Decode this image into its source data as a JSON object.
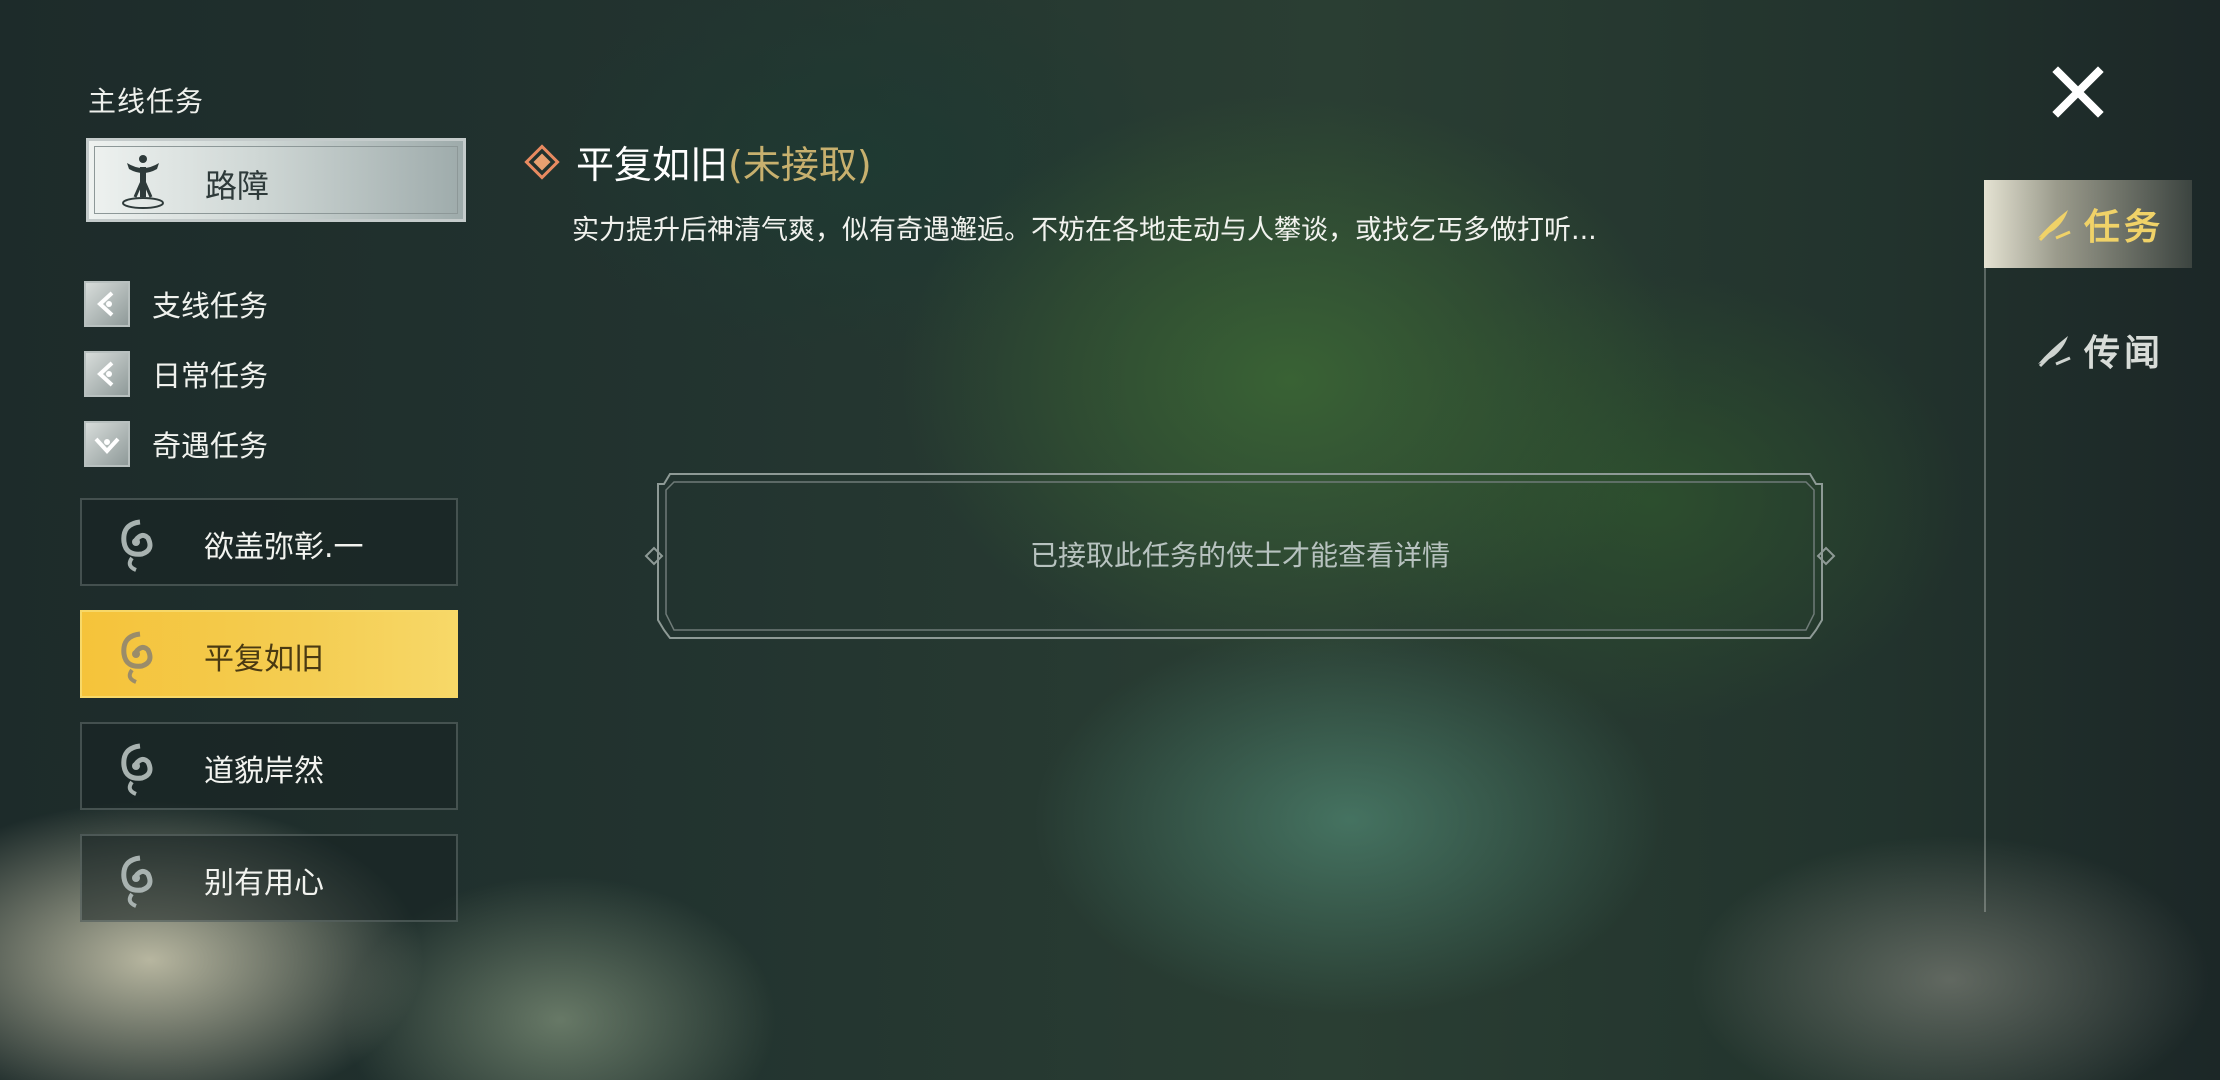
{
  "left_menu": {
    "main_header": "主线任务",
    "main_card": {
      "label": "路障",
      "icon": "tripod-emblem-icon"
    },
    "categories": [
      {
        "label": "支线任务",
        "icon": "chevron-left-emblem-icon"
      },
      {
        "label": "日常任务",
        "icon": "chevron-left-emblem-icon"
      },
      {
        "label": "奇遇任务",
        "icon": "chevron-down-emblem-icon"
      }
    ],
    "quests": [
      {
        "label": "欲盖弥彰.一",
        "icon": "scroll-swirl-icon",
        "selected": false
      },
      {
        "label": "平复如旧",
        "icon": "scroll-swirl-icon",
        "selected": true
      },
      {
        "label": "道貌岸然",
        "icon": "scroll-swirl-icon",
        "selected": false
      },
      {
        "label": "别有用心",
        "icon": "scroll-swirl-icon",
        "selected": false
      }
    ]
  },
  "detail": {
    "title": "平复如旧",
    "status": "(未接取)",
    "description": "实力提升后神清气爽，似有奇遇邂逅。不妨在各地走动与人攀谈，或找乞丐多做打听...",
    "locked_notice": "已接取此任务的侠士才能查看详情"
  },
  "right_tabs": {
    "close_icon": "close-icon",
    "tabs": [
      {
        "label": "任务",
        "icon": "quill-icon",
        "active": true
      },
      {
        "label": "传闻",
        "icon": "quill-icon",
        "active": false
      }
    ]
  },
  "colors": {
    "accent_gold": "#f4c84a",
    "status_gold": "#c7b06e",
    "active_tab_text": "#f0d268"
  }
}
